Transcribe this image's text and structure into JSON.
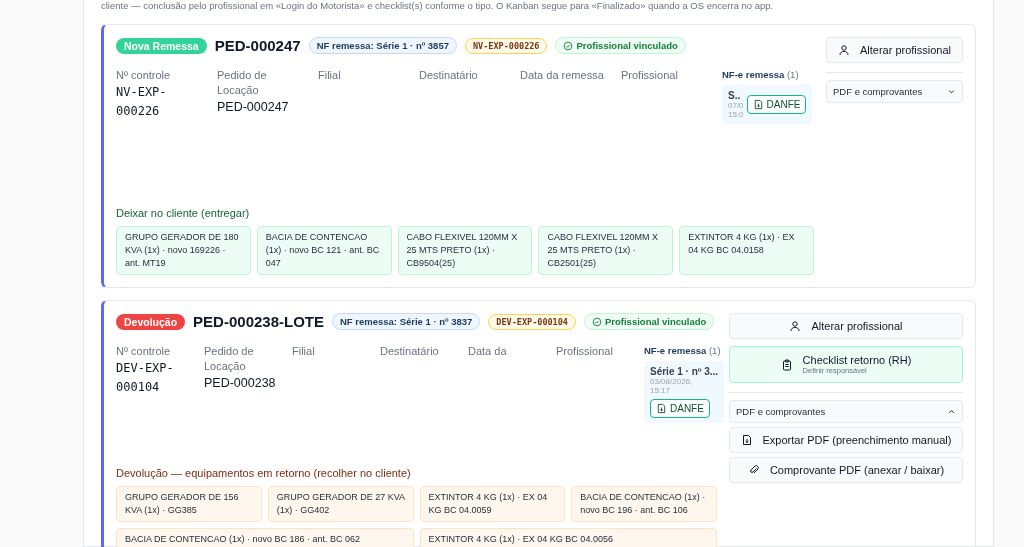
{
  "intro": "cliente — conclusão pelo profissional em «Login do Motorista» e checklist(s) conforme o tipo. O Kanban segue para «Finalizado» quando a OS encerra no app.",
  "cards": [
    {
      "kind": "nova",
      "badge": "Nova Remessa",
      "title": "PED-000247",
      "nf_tag": "NF remessa: Série 1 · nº 3857",
      "code_tag": "NV-EXP-000226",
      "status_tag": "Profissional vinculado",
      "fields": [
        {
          "label": "Nº controle",
          "value": "NV-EXP-000226"
        },
        {
          "label": "Pedido de Locação",
          "value": "PED-000247"
        },
        {
          "label": "Filial"
        },
        {
          "label": "Destinatário"
        },
        {
          "label": "Data da remessa"
        },
        {
          "label": "Profissional"
        }
      ],
      "nfe": {
        "title": "NF-e remessa",
        "count": "(1)",
        "entry_title": "S..",
        "entry_date": "07/0",
        "entry_time": "15:0",
        "button": "DANFE"
      },
      "items_title": "Deixar no cliente (entregar)",
      "items": [
        {
          "text": "GRUPO GERADOR DE 180 KVA (1x) · novo 169226 · ant. MT19",
          "wide": false
        },
        {
          "text": "BACIA DE CONTENCAO (1x) · novo BC 121 · ant. BC 047",
          "wide": false
        },
        {
          "text": "CABO FLEXIVEL 120MM X 25 MTS PRETO (1x) · CB9504(25)",
          "wide": false
        },
        {
          "text": "CABO FLEXIVEL 120MM X 25 MTS PRETO (1x) · CB2501(25)",
          "wide": false
        },
        {
          "text": "EXTINTOR 4 KG (1x) · EX 04 KG BC 04.0158",
          "wide": false
        }
      ],
      "actions": [
        {
          "kind": "plain",
          "label": "Alterar profissional"
        }
      ],
      "pdf": {
        "label": "PDF e comprovantes",
        "expanded": false
      }
    },
    {
      "kind": "devolucao",
      "badge": "Devolução",
      "title": "PED-000238-LOTE",
      "nf_tag": "NF remessa: Série 1 · nº 3837",
      "code_tag": "DEV-EXP-000104",
      "status_tag": "Profissional vinculado",
      "fields": [
        {
          "label": "Nº controle",
          "value": "DEV-EXP-000104"
        },
        {
          "label": "Pedido de Locação",
          "value": "PED-000238"
        },
        {
          "label": "Filial"
        },
        {
          "label": "Destinatário"
        },
        {
          "label": "Data da"
        },
        {
          "label": "Profissional"
        }
      ],
      "nfe": {
        "title": "NF-e remessa",
        "count": "(1)",
        "entry_title": "Série 1 · nº 3...",
        "entry_date": "03/08/2026,",
        "entry_time": "15:17",
        "button": "DANFE"
      },
      "items_title": "Devolução — equipamentos em retorno (recolher no cliente)",
      "items": [
        {
          "text": "GRUPO GERADOR DE 156 KVA (1x) · GG385",
          "wide": false
        },
        {
          "text": "GRUPO GERADOR DE 27 KVA (1x) · GG402",
          "wide": false
        },
        {
          "text": "EXTINTOR 4 KG (1x) · EX 04 KG BC 04.0059",
          "wide": false
        },
        {
          "text": "BACIA DE CONTENCAO (1x) · novo BC 196 · ant. BC 106",
          "wide": false
        },
        {
          "text": "BACIA DE CONTENCAO (1x) · novo BC 186 · ant. BC 062",
          "wide": true
        },
        {
          "text": "EXTINTOR 4 KG (1x) · EX 04 KG BC 04.0056",
          "wide": true
        }
      ],
      "actions": [
        {
          "kind": "plain",
          "label": "Alterar profissional"
        },
        {
          "kind": "checklist",
          "label": "Checklist retorno (RH)",
          "sub": "Definir responsável"
        }
      ],
      "pdf": {
        "label": "PDF e comprovantes",
        "expanded": true,
        "buttons": [
          {
            "kind": "export",
            "label": "Exportar PDF (preenchimento manual)"
          },
          {
            "kind": "attach",
            "label": "Comprovante PDF (anexar / baixar)"
          }
        ]
      }
    }
  ]
}
